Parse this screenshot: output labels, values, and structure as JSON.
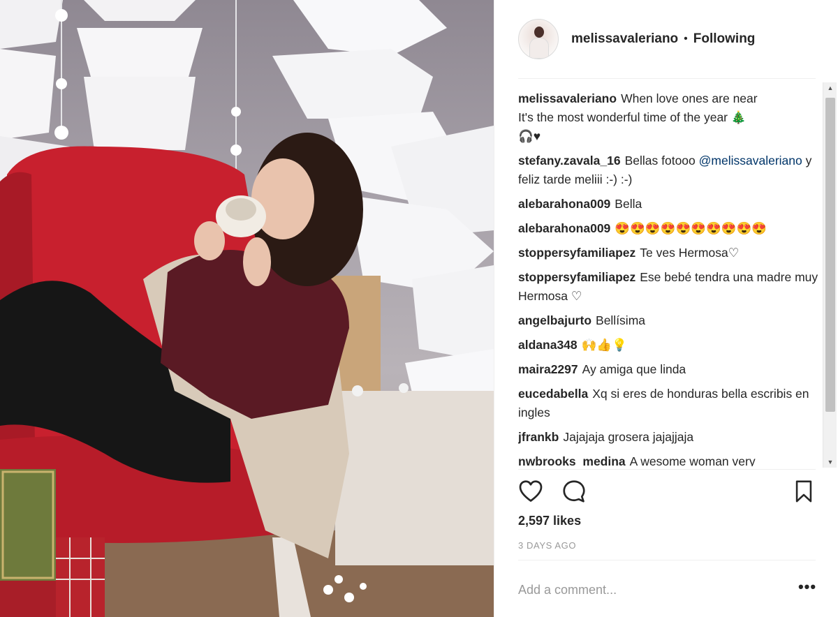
{
  "post": {
    "username": "melissavaleriano",
    "separator": "•",
    "follow_status": "Following",
    "caption": {
      "username": "melissavaleriano",
      "text": "When love ones are near\nIt's the most wonderful time of the year 🎄\n🎧♥"
    },
    "comments": [
      {
        "username": "stefany.zavala_16",
        "text_before": "Bellas fotooo",
        "mention": "@melissavaleriano",
        "text_after": "y feliz tarde meliii :-) :-)"
      },
      {
        "username": "alebarahona009",
        "text": "Bella"
      },
      {
        "username": "alebarahona009",
        "text": "😍😍😍😍😍😍😍😍😍😍"
      },
      {
        "username": "stoppersyfamiliapez",
        "text": "Te ves Hermosa♡"
      },
      {
        "username": "stoppersyfamiliapez",
        "text": "Ese bebé tendra una madre muy Hermosa ♡"
      },
      {
        "username": "angelbajurto",
        "text": "Bellísima"
      },
      {
        "username": "aldana348",
        "text": "🙌👍💡"
      },
      {
        "username": "maira2297",
        "text": "Ay amiga que linda"
      },
      {
        "username": "eucedabella",
        "text": "Xq si eres de honduras bella escribis en ingles"
      },
      {
        "username": "jfrankb",
        "text": "Jajajaja grosera jajajjaja"
      },
      {
        "username": "nwbrooks_medina",
        "text": "A wesome woman very"
      }
    ],
    "likes": "2,597 likes",
    "time_ago": "3 DAYS AGO",
    "add_comment_placeholder": "Add a comment...",
    "more_options": "•••"
  },
  "icons": {
    "like": "heart-icon",
    "comment": "speech-bubble-icon",
    "save": "bookmark-icon",
    "scroll_up": "arrow-up-icon",
    "scroll_down": "arrow-down-icon"
  },
  "colors": {
    "text": "#262626",
    "muted": "#999999",
    "mention": "#003569",
    "divider": "#efefef",
    "chair_red": "#c8202e",
    "sweater": "#5a1a24"
  }
}
